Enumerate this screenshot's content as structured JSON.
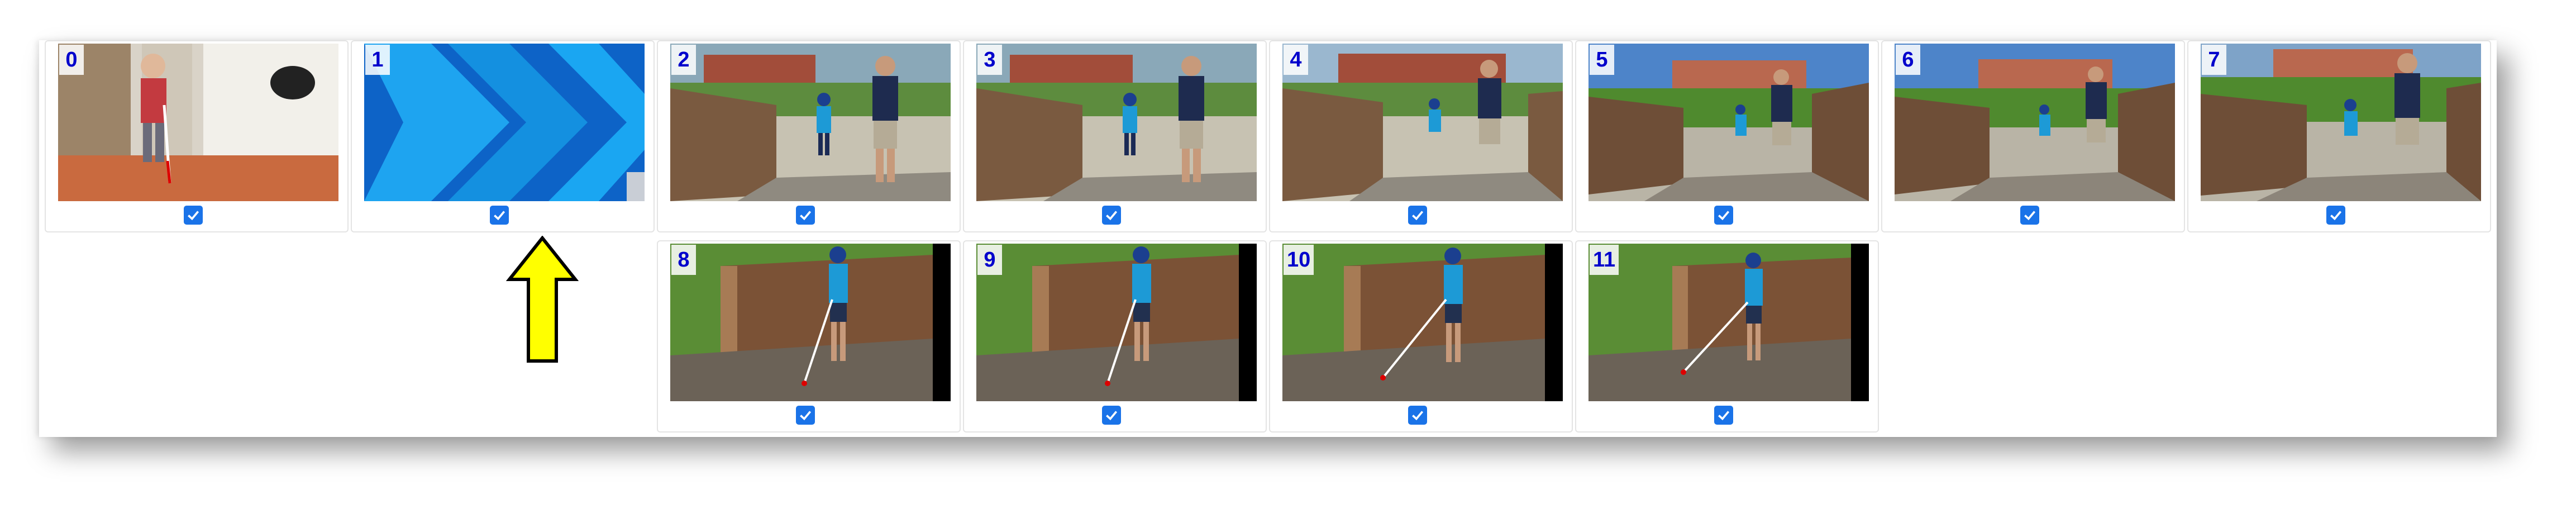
{
  "frames": [
    {
      "index": "0",
      "selected": true,
      "scene": "hallway-boy-with-cane"
    },
    {
      "index": "1",
      "selected": true,
      "scene": "blue-chevron-title-card"
    },
    {
      "index": "2",
      "selected": true,
      "scene": "boardwalk-boy-and-adult"
    },
    {
      "index": "3",
      "selected": true,
      "scene": "boardwalk-boy-and-adult"
    },
    {
      "index": "4",
      "selected": true,
      "scene": "boardwalk-boy-and-adult"
    },
    {
      "index": "5",
      "selected": true,
      "scene": "boardwalk-boy-and-adult"
    },
    {
      "index": "6",
      "selected": true,
      "scene": "boardwalk-boy-and-adult"
    },
    {
      "index": "7",
      "selected": true,
      "scene": "boardwalk-boy-and-adult"
    },
    {
      "index": "8",
      "selected": true,
      "scene": "boy-with-cane-by-fence"
    },
    {
      "index": "9",
      "selected": true,
      "scene": "boy-with-cane-by-fence"
    },
    {
      "index": "10",
      "selected": true,
      "scene": "boy-with-cane-by-fence"
    },
    {
      "index": "11",
      "selected": true,
      "scene": "boy-with-cane-by-fence"
    }
  ],
  "indicator": {
    "icon": "up-arrow-icon",
    "color": "#ffff00",
    "outline": "#000000"
  },
  "colors": {
    "badge_text": "#0000cc",
    "checkbox": "#1a73e8"
  }
}
